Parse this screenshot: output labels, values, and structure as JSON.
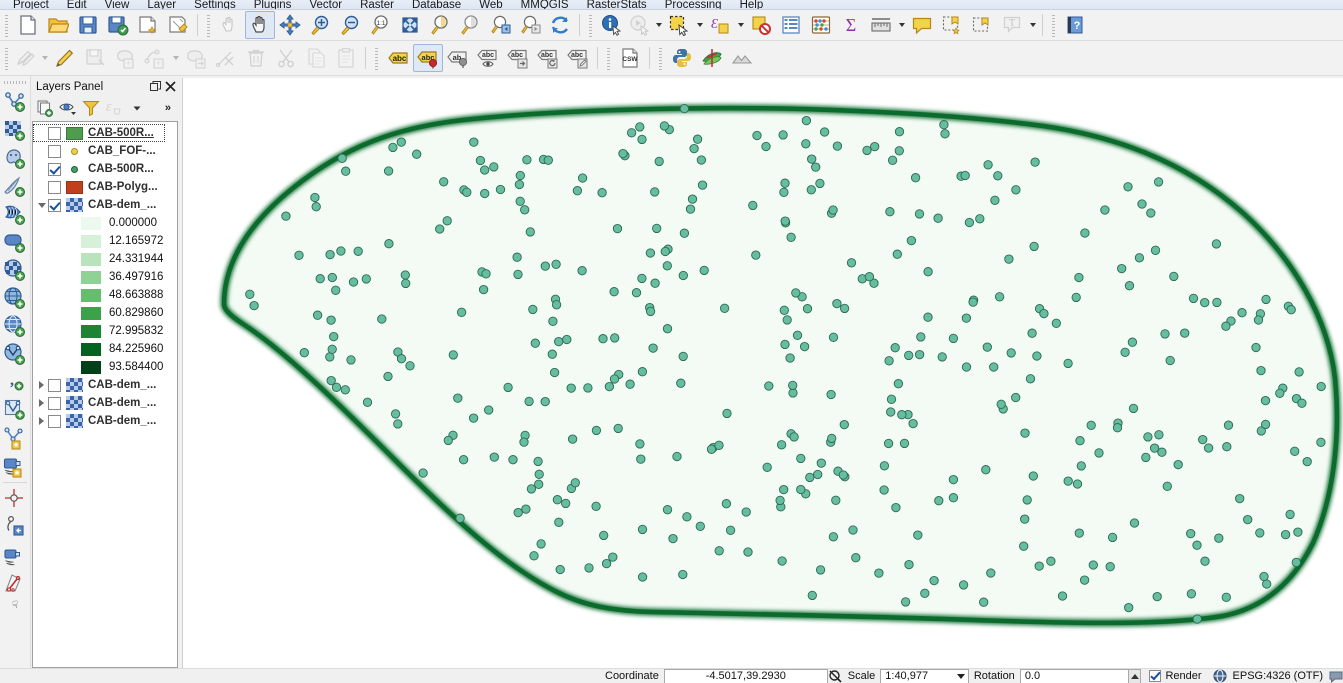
{
  "app": {
    "title": "QGIS"
  },
  "menubar": {
    "items": [
      {
        "label": "Project"
      },
      {
        "label": "Edit"
      },
      {
        "label": "View"
      },
      {
        "label": "Layer"
      },
      {
        "label": "Settings"
      },
      {
        "label": "Plugins"
      },
      {
        "label": "Vector"
      },
      {
        "label": "Raster"
      },
      {
        "label": "Database"
      },
      {
        "label": "Web"
      },
      {
        "label": "MMQGIS"
      },
      {
        "label": "RasterStats"
      },
      {
        "label": "Processing"
      },
      {
        "label": "Help"
      }
    ]
  },
  "toolbar1": {
    "buttons": [
      {
        "name": "new-project-icon",
        "tip": "New Project"
      },
      {
        "name": "open-project-icon",
        "tip": "Open Project"
      },
      {
        "name": "save-project-icon",
        "tip": "Save Project"
      },
      {
        "name": "save-project-as-icon",
        "tip": "Save Project As"
      },
      {
        "name": "new-print-composer-icon",
        "tip": "New Print Composer"
      },
      {
        "name": "composer-manager-icon",
        "tip": "Composer Manager"
      },
      {
        "name": "touch-zoom-icon",
        "tip": "Touch Zoom and Pan"
      },
      {
        "name": "pan-map-icon",
        "tip": "Pan Map",
        "active": true
      },
      {
        "name": "pan-to-selection-icon",
        "tip": "Pan Map to Selection"
      },
      {
        "name": "zoom-in-icon",
        "tip": "Zoom In"
      },
      {
        "name": "zoom-out-icon",
        "tip": "Zoom Out"
      },
      {
        "name": "zoom-native-icon",
        "tip": "Zoom to Native Resolution"
      },
      {
        "name": "zoom-full-icon",
        "tip": "Zoom Full"
      },
      {
        "name": "zoom-to-selection-icon",
        "tip": "Zoom to Selection"
      },
      {
        "name": "zoom-to-layer-icon",
        "tip": "Zoom to Layer"
      },
      {
        "name": "zoom-last-icon",
        "tip": "Zoom Last"
      },
      {
        "name": "zoom-next-icon",
        "tip": "Zoom Next"
      },
      {
        "name": "refresh-icon",
        "tip": "Refresh"
      },
      {
        "name": "identify-features-icon",
        "tip": "Identify Features"
      },
      {
        "name": "run-feature-action-icon",
        "tip": "Run Feature Action"
      },
      {
        "name": "select-features-icon",
        "tip": "Select Features by Area"
      },
      {
        "name": "select-by-expression-icon",
        "tip": "Select by Expression"
      },
      {
        "name": "deselect-features-icon",
        "tip": "Deselect Features"
      },
      {
        "name": "attribute-table-icon",
        "tip": "Open Attribute Table"
      },
      {
        "name": "field-calculator-icon",
        "tip": "Open Field Calculator"
      },
      {
        "name": "statistical-summary-icon",
        "tip": "Show Statistical Summary"
      },
      {
        "name": "measure-line-icon",
        "tip": "Measure Line"
      },
      {
        "name": "map-tips-icon",
        "tip": "Show Map Tips"
      },
      {
        "name": "new-bookmark-icon",
        "tip": "New Bookmark"
      },
      {
        "name": "show-bookmarks-icon",
        "tip": "Show Bookmarks"
      },
      {
        "name": "text-annotation-icon",
        "tip": "Text Annotation"
      },
      {
        "name": "help-contents-icon",
        "tip": "Help Contents"
      }
    ]
  },
  "toolbar2": {
    "buttons": [
      {
        "name": "current-edits-icon",
        "tip": "Current Edits"
      },
      {
        "name": "toggle-editing-icon",
        "tip": "Toggle Editing"
      },
      {
        "name": "save-layer-edits-icon",
        "tip": "Save Layer Edits"
      },
      {
        "name": "add-feature-icon",
        "tip": "Add Feature"
      },
      {
        "name": "add-part-icon",
        "tip": "Add Part"
      },
      {
        "name": "move-feature-icon",
        "tip": "Move Feature"
      },
      {
        "name": "node-tool-icon",
        "tip": "Node Tool"
      },
      {
        "name": "delete-selected-icon",
        "tip": "Delete Selected"
      },
      {
        "name": "cut-features-icon",
        "tip": "Cut Features"
      },
      {
        "name": "copy-features-icon",
        "tip": "Copy Features"
      },
      {
        "name": "paste-features-icon",
        "tip": "Paste Features"
      },
      {
        "name": "label-layer-icon",
        "tip": "Layer Labeling Options"
      },
      {
        "name": "pin-labels-icon",
        "tip": "Pin/Unpin Labels",
        "active": true
      },
      {
        "name": "highlight-labels-icon",
        "tip": "Highlight Pinned Labels"
      },
      {
        "name": "show-hide-labels-icon",
        "tip": "Show/Hide Labels"
      },
      {
        "name": "move-label-icon",
        "tip": "Move Label"
      },
      {
        "name": "rotate-label-icon",
        "tip": "Rotate Label"
      },
      {
        "name": "change-label-icon",
        "tip": "Change Label"
      },
      {
        "name": "csw-client-icon",
        "tip": "MetaSearch CSW Client"
      },
      {
        "name": "python-console-icon",
        "tip": "Python Console"
      },
      {
        "name": "plugin-manager-icon",
        "tip": "Plugin Manager"
      },
      {
        "name": "terrain-icon",
        "tip": "Terrain Analysis"
      }
    ]
  },
  "left_toolbar": {
    "buttons": [
      {
        "name": "add-vector-layer-icon",
        "tip": "Add Vector Layer"
      },
      {
        "name": "add-raster-layer-icon",
        "tip": "Add Raster Layer"
      },
      {
        "name": "add-postgis-layer-icon",
        "tip": "Add PostGIS Layer"
      },
      {
        "name": "add-spatialite-layer-icon",
        "tip": "Add SpatiaLite Layer"
      },
      {
        "name": "add-mssql-layer-icon",
        "tip": "Add MSSQL Spatial Layer"
      },
      {
        "name": "add-oracle-layer-icon",
        "tip": "Add Oracle Spatial Layer"
      },
      {
        "name": "add-wms-layer-icon",
        "tip": "Add WMS/WMTS Layer"
      },
      {
        "name": "add-wcs-layer-icon",
        "tip": "Add WCS Layer"
      },
      {
        "name": "add-wfs-layer-icon",
        "tip": "Add WFS Layer"
      },
      {
        "name": "add-delimited-text-layer-icon",
        "tip": "Add Delimited Text Layer"
      },
      {
        "name": "new-shapefile-layer-icon",
        "tip": "New Shapefile Layer"
      },
      {
        "name": "new-spatialite-layer-icon",
        "tip": "New SpatiaLite Layer"
      },
      {
        "name": "new-memory-layer-icon",
        "tip": "New Memory Layer"
      },
      {
        "name": "georeferencer-icon",
        "tip": "Georeferencer"
      },
      {
        "name": "dxf2shp-icon",
        "tip": "DXF2Shape Converter"
      },
      {
        "name": "openlayers-plugin-icon",
        "tip": "OpenLayers Plugin"
      },
      {
        "name": "road-graph-icon",
        "tip": "Road Graph"
      },
      {
        "name": "more-tools-icon",
        "tip": "More Tools"
      }
    ]
  },
  "layers_panel": {
    "title": "Layers Panel",
    "float_icon": "restore-icon",
    "close_icon": "close-icon",
    "toolbar": [
      {
        "name": "add-group-icon",
        "tip": "Add Group"
      },
      {
        "name": "manage-visibility-icon",
        "tip": "Manage Layer Visibility"
      },
      {
        "name": "filter-legend-icon",
        "tip": "Filter Legend by Map Content"
      },
      {
        "name": "expression-filter-icon",
        "tip": "Filter Legend by Expression"
      },
      {
        "name": "more-options-icon",
        "tip": "More options",
        "label": "»"
      }
    ],
    "layers": [
      {
        "name": "CAB-500R...",
        "checked": false,
        "symbol": "polygon-green",
        "selected": true,
        "expandable": false
      },
      {
        "name": "CAB_FOF-...",
        "checked": false,
        "symbol": "point-yellow",
        "expandable": false
      },
      {
        "name": "CAB-500R...",
        "checked": true,
        "symbol": "point-green",
        "expandable": false
      },
      {
        "name": "CAB-Polyg...",
        "checked": false,
        "symbol": "polygon-red",
        "expandable": false
      },
      {
        "name": "CAB-dem_...",
        "checked": true,
        "symbol": "raster",
        "expandable": true,
        "expanded": true
      },
      {
        "name": "CAB-dem_...",
        "checked": false,
        "symbol": "raster",
        "expandable": true,
        "expanded": false
      },
      {
        "name": "CAB-dem_...",
        "checked": false,
        "symbol": "raster",
        "expandable": true,
        "expanded": false
      },
      {
        "name": "CAB-dem_...",
        "checked": false,
        "symbol": "raster",
        "expandable": true,
        "expanded": false
      }
    ],
    "raster_legend": [
      {
        "value": "0.000000",
        "color": "#edf8ee"
      },
      {
        "value": "12.165972",
        "color": "#d7f0d9"
      },
      {
        "value": "24.331944",
        "color": "#b8e3bb"
      },
      {
        "value": "36.497916",
        "color": "#90d295"
      },
      {
        "value": "48.663888",
        "color": "#66bd6d"
      },
      {
        "value": "60.829860",
        "color": "#3ca24a"
      },
      {
        "value": "72.995832",
        "color": "#1d8434"
      },
      {
        "value": "84.225960",
        "color": "#056322"
      },
      {
        "value": "93.584400",
        "color": "#00401a"
      }
    ]
  },
  "map": {
    "polygon_stroke": "#0a6b2d",
    "polygon_fill": "#f4fbf4",
    "point_fill": "#66bda0",
    "point_stroke": "#2b6b52",
    "background": "#ffffff",
    "point_count": 420
  },
  "status_bar": {
    "coordinate_label": "Coordinate",
    "coordinate_value": "-4.5017,39.2930",
    "toggle_extents_icon": "toggle-extents-icon",
    "scale_label": "Scale",
    "scale_value": "1:40,977",
    "rotation_label": "Rotation",
    "rotation_value": "0.0",
    "render_label": "Render",
    "render_checked": true,
    "crs_icon": "crs-icon",
    "crs_label": "EPSG:4326 (OTF)",
    "messages_icon": "messages-icon"
  }
}
